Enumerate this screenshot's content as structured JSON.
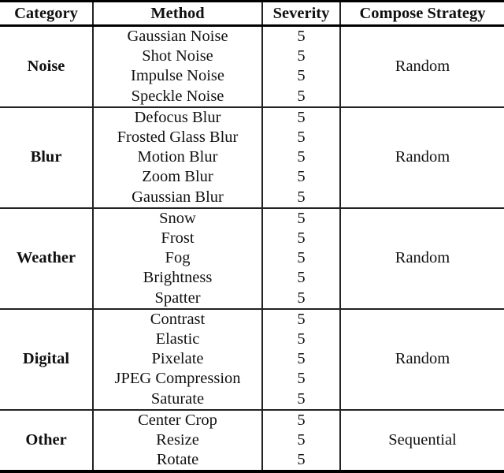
{
  "table": {
    "headers": [
      "Category",
      "Method",
      "Severity",
      "Compose Strategy"
    ],
    "groups": [
      {
        "category": "Noise",
        "strategy": "Random",
        "rows": [
          {
            "method": "Gaussian Noise",
            "severity": "5"
          },
          {
            "method": "Shot Noise",
            "severity": "5"
          },
          {
            "method": "Impulse Noise",
            "severity": "5"
          },
          {
            "method": "Speckle Noise",
            "severity": "5"
          }
        ]
      },
      {
        "category": "Blur",
        "strategy": "Random",
        "rows": [
          {
            "method": "Defocus Blur",
            "severity": "5"
          },
          {
            "method": "Frosted Glass Blur",
            "severity": "5"
          },
          {
            "method": "Motion Blur",
            "severity": "5"
          },
          {
            "method": "Zoom Blur",
            "severity": "5"
          },
          {
            "method": "Gaussian Blur",
            "severity": "5"
          }
        ]
      },
      {
        "category": "Weather",
        "strategy": "Random",
        "rows": [
          {
            "method": "Snow",
            "severity": "5"
          },
          {
            "method": "Frost",
            "severity": "5"
          },
          {
            "method": "Fog",
            "severity": "5"
          },
          {
            "method": "Brightness",
            "severity": "5"
          },
          {
            "method": "Spatter",
            "severity": "5"
          }
        ]
      },
      {
        "category": "Digital",
        "strategy": "Random",
        "rows": [
          {
            "method": "Contrast",
            "severity": "5"
          },
          {
            "method": "Elastic",
            "severity": "5"
          },
          {
            "method": "Pixelate",
            "severity": "5"
          },
          {
            "method": "JPEG Compression",
            "severity": "5"
          },
          {
            "method": "Saturate",
            "severity": "5"
          }
        ]
      },
      {
        "category": "Other",
        "strategy": "Sequential",
        "rows": [
          {
            "method": "Center Crop",
            "severity": "5"
          },
          {
            "method": "Resize",
            "severity": "5"
          },
          {
            "method": "Rotate",
            "severity": "5"
          }
        ]
      }
    ]
  }
}
